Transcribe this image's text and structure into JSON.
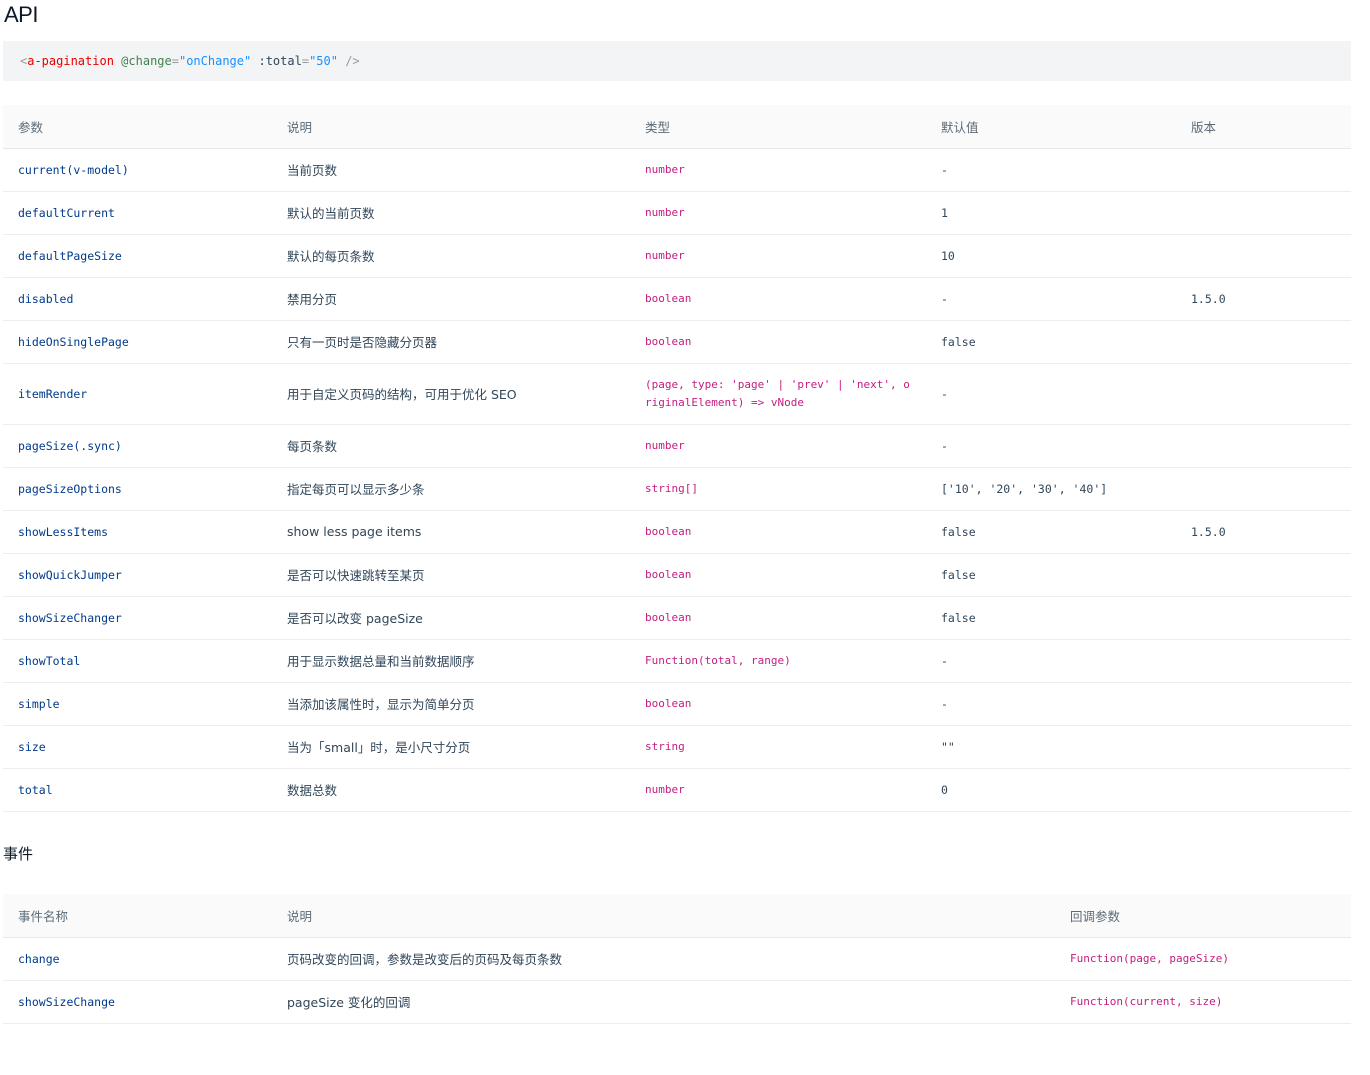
{
  "api_title": "API",
  "code_sample": {
    "open": "<",
    "tag": "a-pagination",
    "attr1": "@change",
    "eq1": "=",
    "val1": "\"onChange\"",
    "attr2": ":total",
    "eq2": "=",
    "val2": "\"50\"",
    "close": "/>"
  },
  "api_table": {
    "headers": [
      "参数",
      "说明",
      "类型",
      "默认值",
      "版本"
    ],
    "rows": [
      {
        "param": "current(v-model)",
        "desc": "当前页数",
        "type": "number",
        "default": "-",
        "version": ""
      },
      {
        "param": "defaultCurrent",
        "desc": "默认的当前页数",
        "type": "number",
        "default": "1",
        "version": ""
      },
      {
        "param": "defaultPageSize",
        "desc": "默认的每页条数",
        "type": "number",
        "default": "10",
        "version": ""
      },
      {
        "param": "disabled",
        "desc": "禁用分页",
        "type": "boolean",
        "default": "-",
        "version": "1.5.0"
      },
      {
        "param": "hideOnSinglePage",
        "desc": "只有一页时是否隐藏分页器",
        "type": "boolean",
        "default": "false",
        "version": ""
      },
      {
        "param": "itemRender",
        "desc": "用于自定义页码的结构，可用于优化 SEO",
        "type": "(page, type: 'page' | 'prev' | 'next', originalElement) => vNode",
        "default": "-",
        "version": ""
      },
      {
        "param": "pageSize(.sync)",
        "desc": "每页条数",
        "type": "number",
        "default": "-",
        "version": ""
      },
      {
        "param": "pageSizeOptions",
        "desc": "指定每页可以显示多少条",
        "type": "string[]",
        "default": "['10', '20', '30', '40']",
        "version": ""
      },
      {
        "param": "showLessItems",
        "desc": "show less page items",
        "type": "boolean",
        "default": "false",
        "version": "1.5.0"
      },
      {
        "param": "showQuickJumper",
        "desc": "是否可以快速跳转至某页",
        "type": "boolean",
        "default": "false",
        "version": ""
      },
      {
        "param": "showSizeChanger",
        "desc": "是否可以改变 pageSize",
        "type": "boolean",
        "default": "false",
        "version": ""
      },
      {
        "param": "showTotal",
        "desc": "用于显示数据总量和当前数据顺序",
        "type": "Function(total, range)",
        "default": "-",
        "version": ""
      },
      {
        "param": "simple",
        "desc": "当添加该属性时，显示为简单分页",
        "type": "boolean",
        "default": "-",
        "version": ""
      },
      {
        "param": "size",
        "desc": "当为「small」时，是小尺寸分页",
        "type": "string",
        "default": "\"\"",
        "version": ""
      },
      {
        "param": "total",
        "desc": "数据总数",
        "type": "number",
        "default": "0",
        "version": ""
      }
    ]
  },
  "events_title": "事件",
  "events_table": {
    "headers": [
      "事件名称",
      "说明",
      "回调参数"
    ],
    "rows": [
      {
        "name": "change",
        "desc": "页码改变的回调，参数是改变后的页码及每页条数",
        "callback": "Function(page, pageSize)"
      },
      {
        "name": "showSizeChange",
        "desc": "pageSize 变化的回调",
        "callback": "Function(current, size)"
      }
    ]
  }
}
